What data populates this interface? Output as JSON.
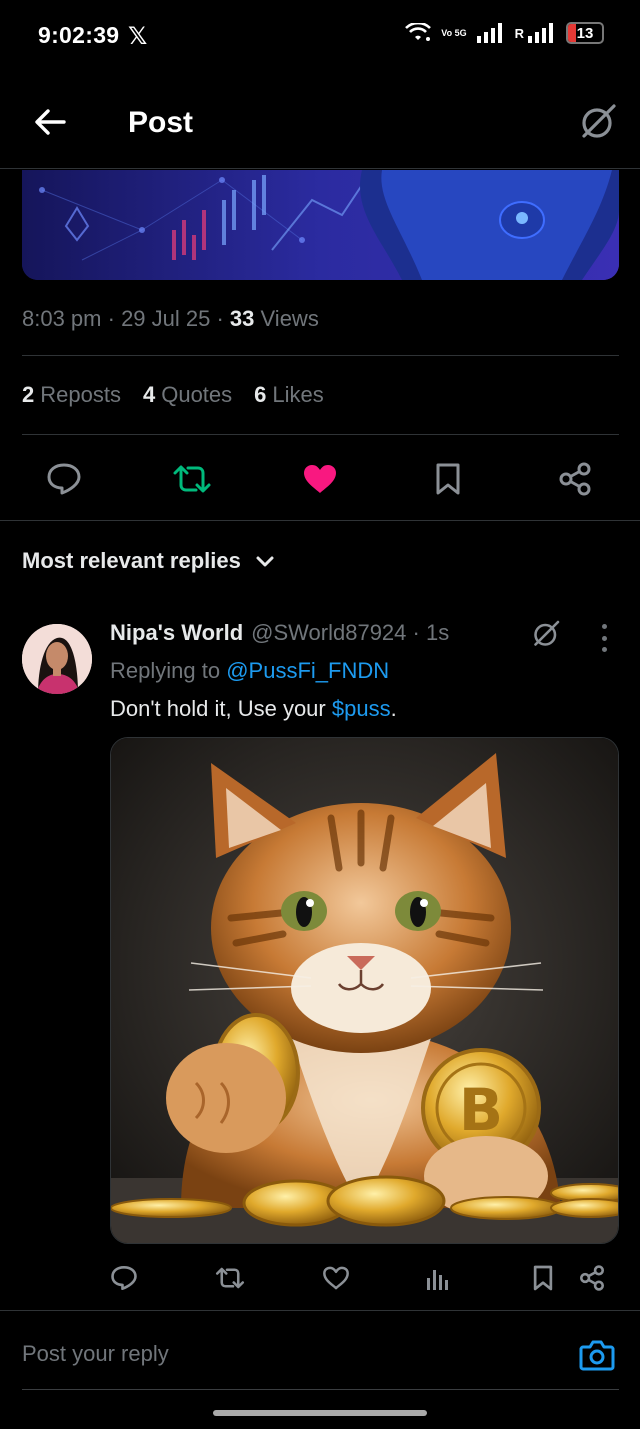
{
  "status_bar": {
    "time": "9:02:39",
    "app_icon": "x-logo",
    "network_label": "Vo 5G",
    "roaming_label": "R",
    "battery_level": "13"
  },
  "header": {
    "title": "Post",
    "back_icon": "arrow-left-icon",
    "grok_icon": "grok-icon"
  },
  "post": {
    "time": "8:03 pm",
    "date": "29 Jul 25",
    "views_count": "33",
    "views_label": "Views",
    "reposts_count": "2",
    "reposts_label": "Reposts",
    "quotes_count": "4",
    "quotes_label": "Quotes",
    "likes_count": "6",
    "likes_label": "Likes",
    "liked": true,
    "reposted": true
  },
  "colors": {
    "accent_blue": "#1d9bf0",
    "repost_green": "#00ba7c",
    "like_pink": "#f91880",
    "muted": "#71767b"
  },
  "replies": {
    "filter_label": "Most relevant replies",
    "items": [
      {
        "name": "Nipa's World",
        "handle": "@SWorld87924",
        "age": "1s",
        "replying_prefix": "Replying to",
        "replying_handle": "@PussFi_FNDN",
        "text_before": "Don't hold it, Use your ",
        "cashtag": "$puss",
        "text_after": "."
      }
    ]
  },
  "compose": {
    "placeholder": "Post your reply"
  }
}
